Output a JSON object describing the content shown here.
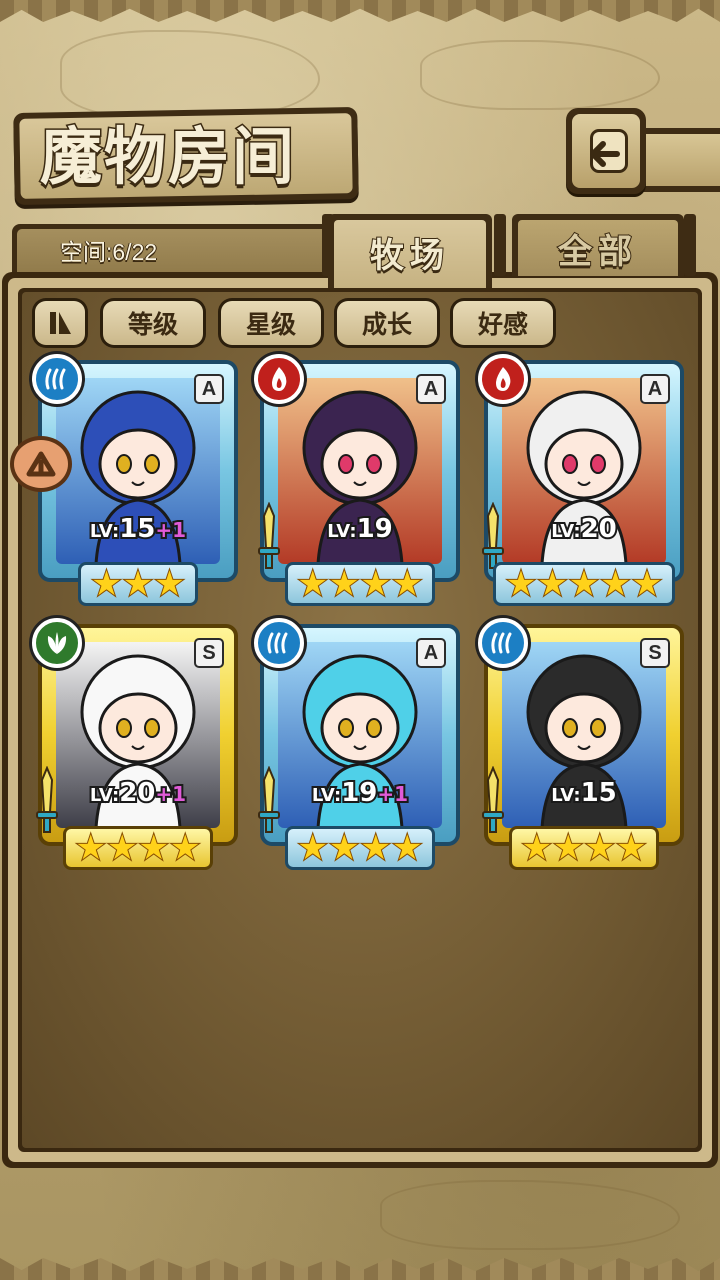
{
  "screen": {
    "title": "魔物房间",
    "space_label": "空间:6/22"
  },
  "tabs": [
    {
      "label": "牧场",
      "active": true
    },
    {
      "label": "全部",
      "active": false
    }
  ],
  "filters": {
    "toggle_icon": "play-pause-icon",
    "buttons": [
      "等级",
      "星级",
      "成长",
      "好感"
    ]
  },
  "monsters": [
    {
      "element": "water",
      "rank": "A",
      "level_prefix": "LV:",
      "level": "15",
      "bonus": "+1",
      "stars": 3,
      "portrait": "blue-haired catgirl with bell",
      "has_sword": false
    },
    {
      "element": "fire",
      "rank": "A",
      "level_prefix": "LV:",
      "level": "19",
      "bonus": "",
      "stars": 4,
      "portrait": "fox girl in kimono",
      "has_sword": true
    },
    {
      "element": "fire",
      "rank": "A",
      "level_prefix": "LV:",
      "level": "20",
      "bonus": "",
      "stars": 5,
      "portrait": "horned white demon girl",
      "has_sword": true
    },
    {
      "element": "grass",
      "rank": "S",
      "level_prefix": "LV:",
      "level": "20",
      "bonus": "+1",
      "stars": 4,
      "portrait": "white-haired wolf girl",
      "has_sword": true
    },
    {
      "element": "water",
      "rank": "A",
      "level_prefix": "LV:",
      "level": "19",
      "bonus": "+1",
      "stars": 4,
      "portrait": "cyan-haired girl with float ring",
      "has_sword": true
    },
    {
      "element": "water",
      "rank": "S",
      "level_prefix": "LV:",
      "level": "15",
      "bonus": "",
      "stars": 4,
      "portrait": "feathered headdress girl",
      "has_sword": true
    }
  ],
  "colors": {
    "water": "#1c7fc4",
    "fire": "#c0201c",
    "grass": "#2f7a2c",
    "frame_a": "#78c6e2",
    "frame_s": "#f0d030",
    "bonus": "#e05bd8"
  }
}
